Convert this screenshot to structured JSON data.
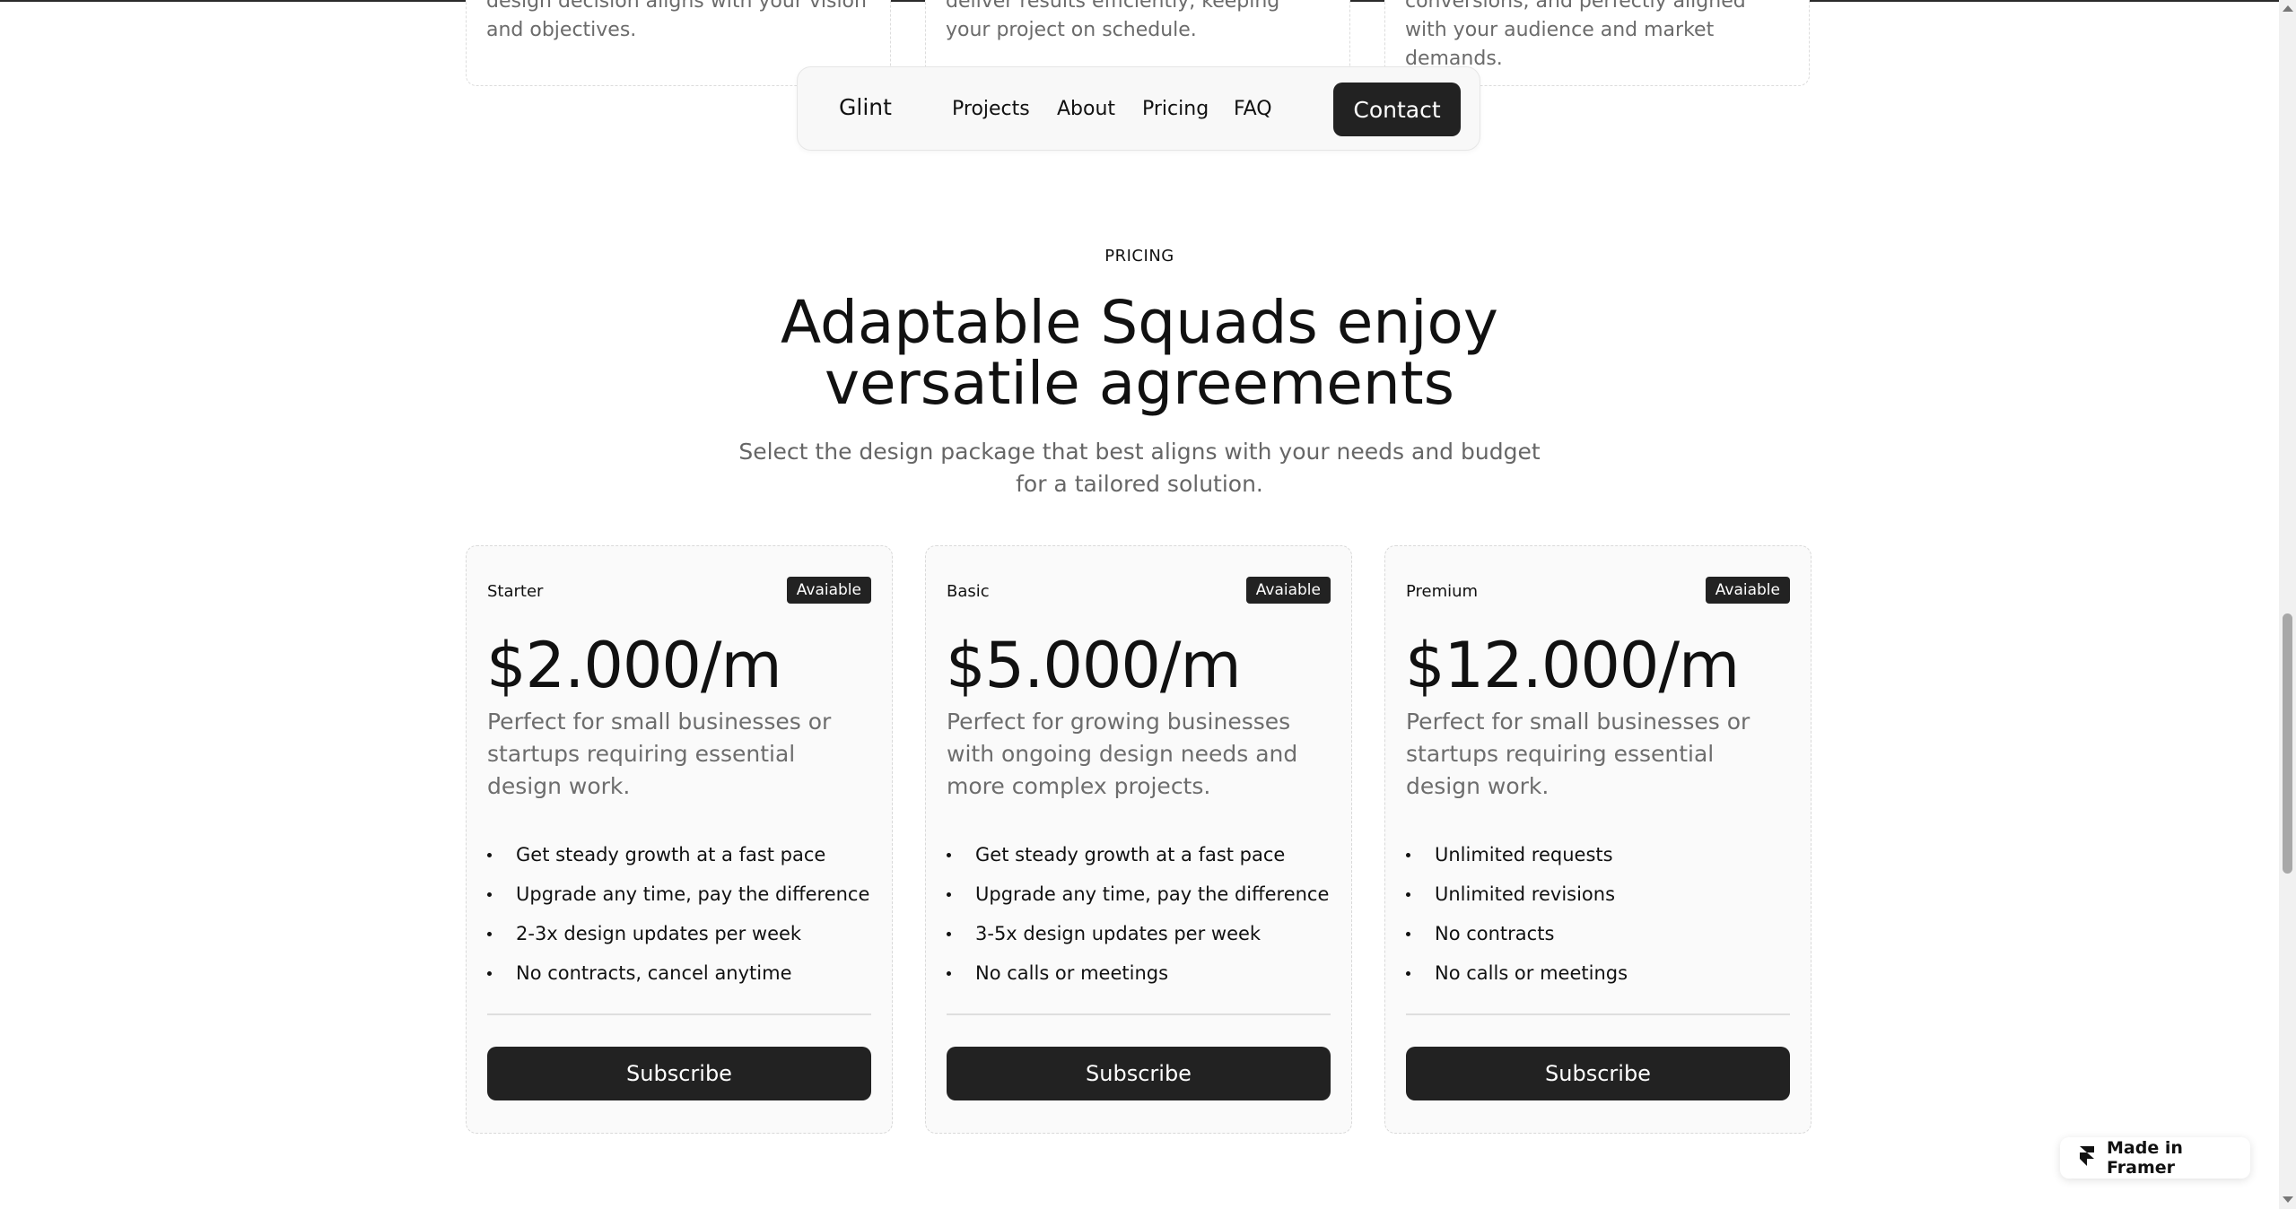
{
  "previous_section": {
    "cards": [
      {
        "text": "design decision aligns with your vision and objectives."
      },
      {
        "text": "deliver results efficiently, keeping your project on schedule."
      },
      {
        "text": "conversions, and perfectly aligned with your audience and market demands."
      }
    ]
  },
  "nav": {
    "brand": "Glint",
    "links": [
      "Projects",
      "About",
      "Pricing",
      "FAQ"
    ],
    "contact_label": "Contact"
  },
  "pricing": {
    "eyebrow": "PRICING",
    "title": "Adaptable Squads enjoy versatile agreements",
    "subtitle": "Select the design package that best aligns with your needs and budget for a tailored solution.",
    "plans": [
      {
        "name": "Starter",
        "badge": "Avaiable",
        "price": "$2.000/m",
        "description": "Perfect for small businesses or startups requiring essential design work.",
        "features": [
          "Get steady growth at a fast pace",
          "Upgrade any time, pay the difference",
          "2-3x design updates per week",
          "No contracts, cancel anytime"
        ],
        "cta": "Subscribe"
      },
      {
        "name": "Basic",
        "badge": "Avaiable",
        "price": "$5.000/m",
        "description": "Perfect for growing businesses with ongoing design needs and more complex projects.",
        "features": [
          "Get steady growth at a fast pace",
          "Upgrade any time, pay the difference",
          "3-5x design updates per week",
          "No calls or meetings"
        ],
        "cta": "Subscribe"
      },
      {
        "name": "Premium",
        "badge": "Avaiable",
        "price": "$12.000/m",
        "description": "Perfect for small businesses or startups requiring essential design work.",
        "features": [
          "Unlimited requests",
          "Unlimited revisions",
          "No contracts",
          "No calls or meetings"
        ],
        "cta": "Subscribe"
      }
    ]
  },
  "framer_badge": {
    "label": "Made in Framer",
    "icon": "framer-icon"
  },
  "colors": {
    "button_dark": "#222222",
    "card_bg": "#fafafa",
    "muted_text": "#6d6d6d"
  }
}
